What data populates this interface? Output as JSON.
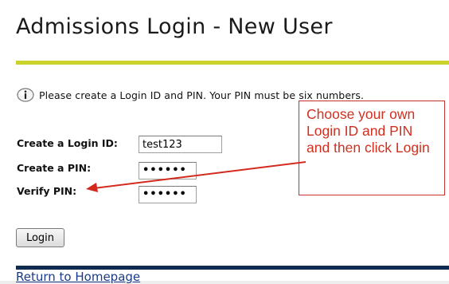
{
  "page": {
    "title": "Admissions Login - New User"
  },
  "info": {
    "icon": "info-icon",
    "message": "Please create a Login ID and PIN. Your PIN must be six numbers."
  },
  "form": {
    "login_id_label": "Create a Login ID:",
    "login_id_value": "test123",
    "pin_label": "Create a PIN:",
    "pin_value": "••••••",
    "verify_label": "Verify PIN:",
    "verify_value": "••••••",
    "login_button": "Login"
  },
  "callout": {
    "text": "Choose your own Login ID and PIN and then click Login",
    "color": "#d0301f"
  },
  "footer": {
    "home_link": "Return to Homepage"
  },
  "colors": {
    "top_rule": "#c9d22a",
    "bottom_rule": "#0f2b50",
    "link": "#1b3a86"
  }
}
